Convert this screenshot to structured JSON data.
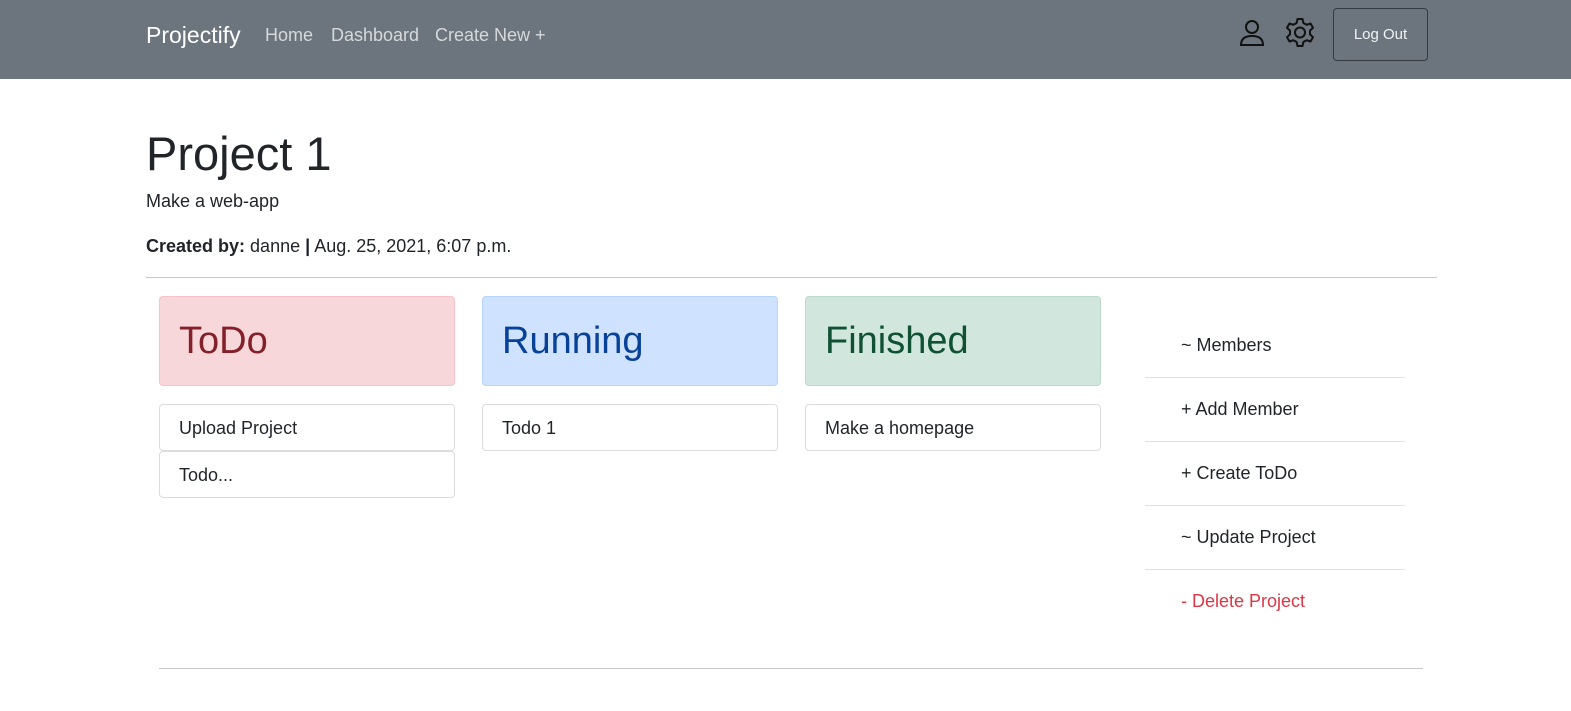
{
  "navbar": {
    "brand": "Projectify",
    "links": [
      "Home",
      "Dashboard",
      "Create New +"
    ],
    "user_icon": "person-outline-icon",
    "settings_icon": "gear-icon",
    "logout_label": "Log Out",
    "background": "#6c757d"
  },
  "project": {
    "title": "Project 1",
    "description": "Make a web-app",
    "created_by_label": "Created by:",
    "created_by": "danne",
    "separator": "|",
    "created_at": "Aug. 25, 2021, 6:07 p.m."
  },
  "columns": [
    {
      "title": "ToDo",
      "color": "#842029",
      "background": "#f8d7da",
      "cards": [
        "Upload Project",
        "Todo..."
      ]
    },
    {
      "title": "Running",
      "color": "#084298",
      "background": "#cfe2ff",
      "cards": [
        "Todo 1"
      ]
    },
    {
      "title": "Finished",
      "color": "#0f5132",
      "background": "#d1e7dd",
      "cards": [
        "Make a homepage"
      ]
    }
  ],
  "sidebar": {
    "items": [
      {
        "label": "~ Members"
      },
      {
        "label": "+ Add Member"
      },
      {
        "label": "+ Create ToDo"
      },
      {
        "label": "~ Update Project"
      },
      {
        "label": "- Delete Project",
        "color": "#dc3545"
      }
    ]
  }
}
